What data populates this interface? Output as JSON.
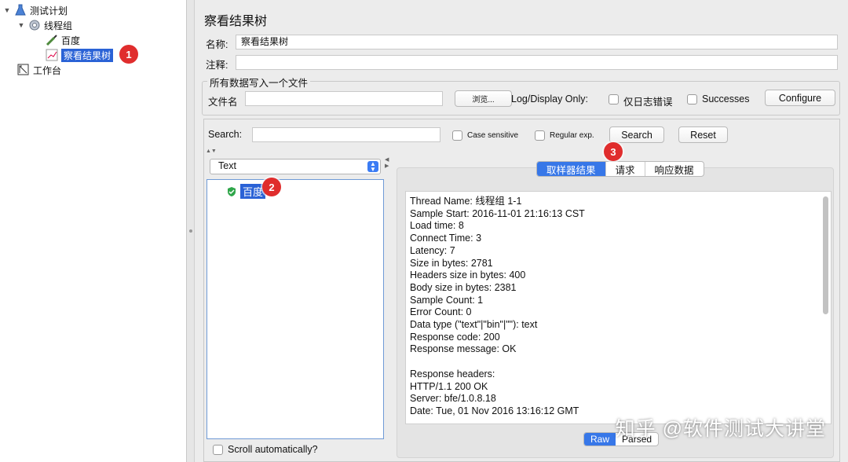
{
  "tree": {
    "test_plan": "测试计划",
    "thread_group": "线程组",
    "sampler": "百度",
    "listener": "察看结果树",
    "workbench": "工作台"
  },
  "badges": [
    "1",
    "2",
    "3"
  ],
  "panel": {
    "title": "察看结果树",
    "name_label": "名称:",
    "name_value": "察看结果树",
    "comment_label": "注释:",
    "comment_value": "",
    "file_group_title": "所有数据写入一个文件",
    "filename_label": "文件名",
    "filename_value": "",
    "browse_button": "浏览...",
    "log_display_only": "Log/Display Only:",
    "errors_only": "仅日志错误",
    "successes": "Successes",
    "configure_button": "Configure"
  },
  "search": {
    "label": "Search:",
    "value": "",
    "case_sensitive": "Case sensitive",
    "regular_exp": "Regular exp.",
    "search_button": "Search",
    "reset_button": "Reset"
  },
  "renderer": {
    "selected": "Text"
  },
  "sample_tree": {
    "item": "百度"
  },
  "tabs": [
    "取样器结果",
    "请求",
    "响应数据"
  ],
  "result_lines": [
    "Thread Name: 线程组 1-1",
    "Sample Start: 2016-11-01 21:16:13 CST",
    "Load time: 8",
    "Connect Time: 3",
    "Latency: 7",
    "Size in bytes: 2781",
    "Headers size in bytes: 400",
    "Body size in bytes: 2381",
    "Sample Count: 1",
    "Error Count: 0",
    "Data type (\"text\"|\"bin\"|\"\"): text",
    "Response code: 200",
    "Response message: OK",
    "",
    "Response headers:",
    "HTTP/1.1 200 OK",
    "Server: bfe/1.0.8.18",
    "Date: Tue, 01 Nov 2016 13:16:12 GMT"
  ],
  "view_toggle": [
    "Raw",
    "Parsed"
  ],
  "scroll_auto": "Scroll automatically?",
  "watermark": "知乎 @软件测试大讲堂",
  "colors": {
    "selection": "#2a62d6",
    "badge": "#e02d2d",
    "active_tab": "#3777e8"
  }
}
